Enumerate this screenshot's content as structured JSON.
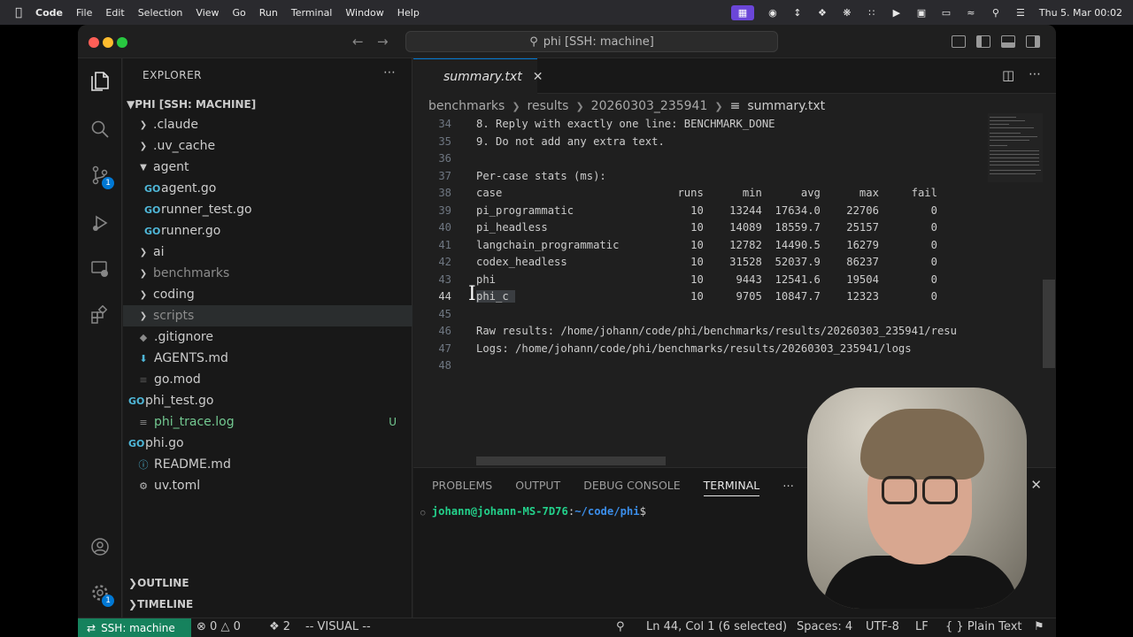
{
  "menubar": {
    "app": "Code",
    "items": [
      "File",
      "Edit",
      "Selection",
      "View",
      "Go",
      "Run",
      "Terminal",
      "Window",
      "Help"
    ],
    "clock": "Thu 5. Mar  00:02"
  },
  "title": {
    "command_center": "phi [SSH: machine]"
  },
  "explorer": {
    "header": "EXPLORER",
    "root": "PHI [SSH: MACHINE]",
    "rows": [
      {
        "label": ".claude",
        "type": "folder"
      },
      {
        "label": ".uv_cache",
        "type": "folder"
      },
      {
        "label": "agent",
        "type": "folder-open"
      },
      {
        "label": "agent.go",
        "type": "go"
      },
      {
        "label": "runner_test.go",
        "type": "go"
      },
      {
        "label": "runner.go",
        "type": "go"
      },
      {
        "label": "ai",
        "type": "folder"
      },
      {
        "label": "benchmarks",
        "type": "folder"
      },
      {
        "label": "coding",
        "type": "folder"
      },
      {
        "label": "scripts",
        "type": "folder"
      },
      {
        "label": ".gitignore",
        "type": "file"
      },
      {
        "label": "AGENTS.md",
        "type": "file"
      },
      {
        "label": "go.mod",
        "type": "file"
      },
      {
        "label": "phi_test.go",
        "type": "go"
      },
      {
        "label": "phi_trace.log",
        "type": "file",
        "mark": "U"
      },
      {
        "label": "phi.go",
        "type": "go"
      },
      {
        "label": "README.md",
        "type": "file"
      },
      {
        "label": "uv.toml",
        "type": "file"
      }
    ],
    "outline": "OUTLINE",
    "timeline": "TIMELINE"
  },
  "editor": {
    "tab": "summary.txt",
    "breadcrumb": [
      "benchmarks",
      "results",
      "20260303_235941",
      "summary.txt"
    ],
    "lines": [
      {
        "n": "34",
        "t": "8. Reply with exactly one line: BENCHMARK_DONE"
      },
      {
        "n": "35",
        "t": "9. Do not add any extra text."
      },
      {
        "n": "36",
        "t": ""
      },
      {
        "n": "37",
        "t": "Per-case stats (ms):"
      },
      {
        "n": "38",
        "t": "case                           runs      min      avg      max     fail"
      },
      {
        "n": "39",
        "t": "pi_programmatic                  10    13244  17634.0    22706        0"
      },
      {
        "n": "40",
        "t": "pi_headless                      10    14089  18559.7    25157        0"
      },
      {
        "n": "41",
        "t": "langchain_programmatic           10    12782  14490.5    16279        0"
      },
      {
        "n": "42",
        "t": "codex_headless                   10    31528  52037.9    86237        0"
      },
      {
        "n": "43",
        "t": "phi                              10     9443  12541.6    19504        0"
      },
      {
        "n": "44",
        "sel": "phi_c ",
        "t": "                           10     9705  10847.7    12323        0"
      },
      {
        "n": "45",
        "t": ""
      },
      {
        "n": "46",
        "t": "Raw results: /home/johann/code/phi/benchmarks/results/20260303_235941/resu"
      },
      {
        "n": "47",
        "t": "Logs: /home/johann/code/phi/benchmarks/results/20260303_235941/logs"
      },
      {
        "n": "48",
        "t": ""
      }
    ]
  },
  "panel": {
    "tabs": [
      "PROBLEMS",
      "OUTPUT",
      "DEBUG CONSOLE",
      "TERMINAL"
    ],
    "terminal": {
      "user": "johann@johann-MS-7D76",
      "path": "~/code/phi",
      "prompt": "$"
    }
  },
  "statusbar": {
    "remote": "SSH: machine",
    "errors": "0",
    "warnings": "0",
    "ports": "2",
    "mode": "-- VISUAL --",
    "position": "Ln 44, Col 1 (6 selected)",
    "spaces": "Spaces: 4",
    "encoding": "UTF-8",
    "eol": "LF",
    "language": "Plain Text"
  }
}
